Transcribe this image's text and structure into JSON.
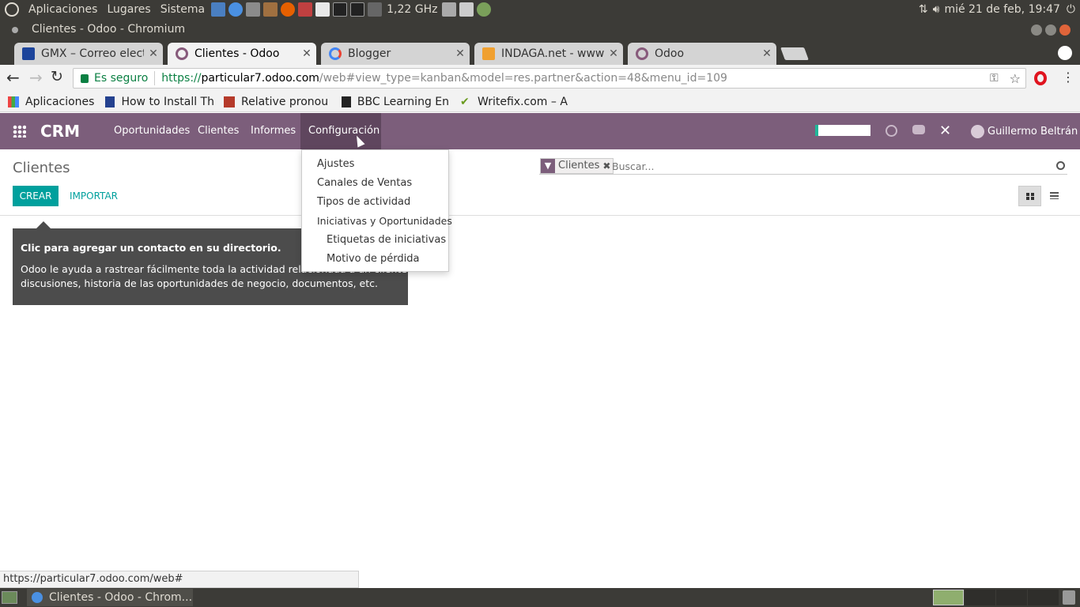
{
  "top_panel": {
    "menus": [
      "Aplicaciones",
      "Lugares",
      "Sistema"
    ],
    "cpu": "1,22 GHz",
    "datetime": "mié 21 de feb, 19:47"
  },
  "window": {
    "title": "Clientes - Odoo - Chromium"
  },
  "tabs": [
    {
      "label": "GMX – Correo electrónico"
    },
    {
      "label": "Clientes - Odoo"
    },
    {
      "label": "Blogger"
    },
    {
      "label": "INDAGA.net - www"
    },
    {
      "label": "Odoo"
    }
  ],
  "omnibox": {
    "secure_label": "Es seguro",
    "url_scheme": "https://",
    "url_host": "particular7.odoo.com",
    "url_path": "/web#view_type=kanban&model=res.partner&action=48&menu_id=109"
  },
  "bookmarks": [
    {
      "label": "Aplicaciones"
    },
    {
      "label": "How to Install Th"
    },
    {
      "label": "Relative pronou"
    },
    {
      "label": "BBC Learning En"
    },
    {
      "label": "Writefix.com – A"
    }
  ],
  "odoo": {
    "app_name": "CRM",
    "menu": [
      "Oportunidades",
      "Clientes",
      "Informes",
      "Configuración"
    ],
    "user": "Guillermo Beltrán",
    "breadcrumb": "Clientes",
    "create_label": "CREAR",
    "import_label": "IMPORTAR",
    "facet_label": "Clientes",
    "search_placeholder": "Buscar...",
    "config_dropdown": [
      "Ajustes",
      "Canales de Ventas",
      "Tipos de actividad",
      "Iniciativas y Oportunidades",
      "Etiquetas de iniciativas",
      "Motivo de pérdida"
    ],
    "help_title": "Clic para agregar un contacto en su directorio.",
    "help_line1": "Odoo le ayuda a rastrear fácilmente toda la actividad relacionada a un cliente:",
    "help_line2": "discusiones, historia de las oportunidades de negocio, documentos, etc."
  },
  "status_url": "https://particular7.odoo.com/web#",
  "taskbar": {
    "task": "Clientes - Odoo - Chrom..."
  },
  "colors": {
    "odoo_purple": "#7c5e7b",
    "odoo_teal": "#00a09d",
    "ubuntu_panel": "#3c3b37"
  }
}
